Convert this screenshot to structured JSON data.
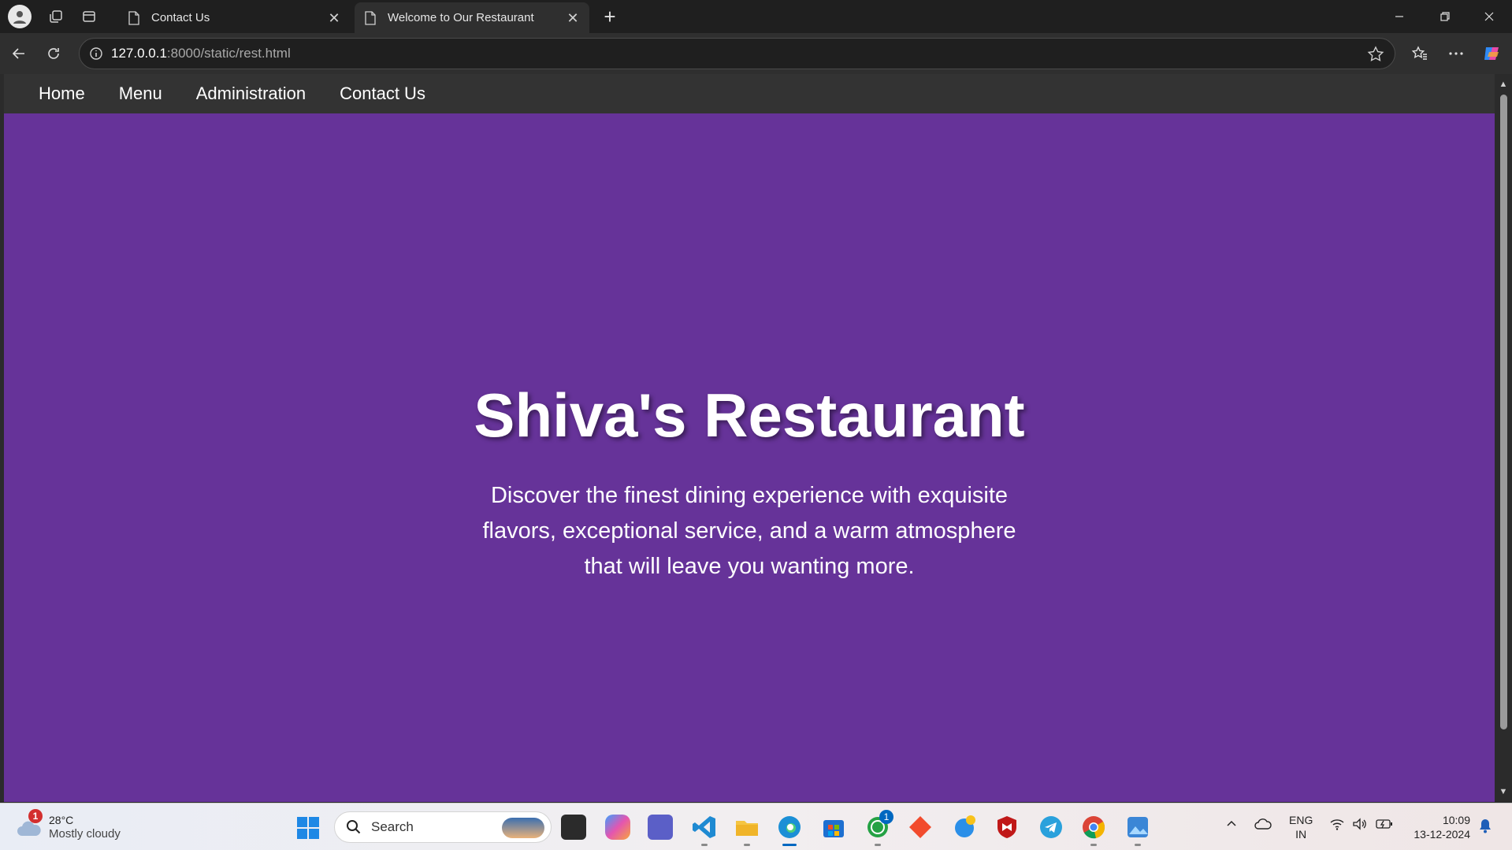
{
  "browser": {
    "tabs": [
      {
        "title": "Contact Us",
        "active": false
      },
      {
        "title": "Welcome to Our Restaurant",
        "active": true
      }
    ],
    "new_tab_label": "+",
    "url_host": "127.0.0.1",
    "url_rest": ":8000/static/rest.html"
  },
  "site": {
    "nav": [
      "Home",
      "Menu",
      "Administration",
      "Contact Us"
    ],
    "title": "Shiva's Restaurant",
    "tagline": "Discover the finest dining experience with exquisite flavors, exceptional service, and a warm atmosphere that will leave you wanting more.",
    "colors": {
      "background": "#663399",
      "navbar": "#333333",
      "text": "#ffffff"
    }
  },
  "taskbar": {
    "weather_badge": "1",
    "temperature": "28°C",
    "condition": "Mostly cloudy",
    "search_label": "Search",
    "whatsapp_badge": "1",
    "lang_1": "ENG",
    "lang_2": "IN",
    "time": "10:09",
    "date": "13-12-2024"
  }
}
